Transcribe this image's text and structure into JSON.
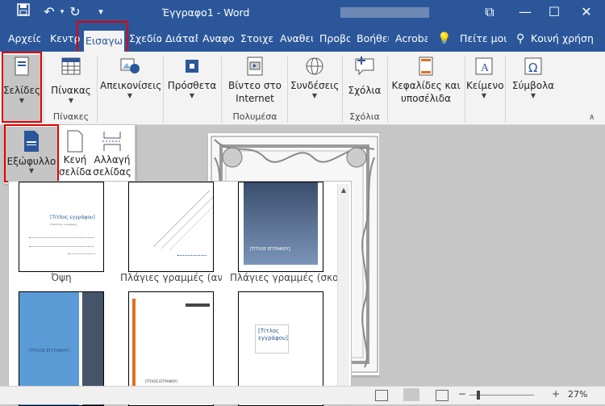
{
  "window": {
    "title": "Έγγραφο1 - Word",
    "controls": {
      "restore": "⧉",
      "minimize": "—",
      "maximize": "☐",
      "close": "✕"
    }
  },
  "quick_access": {
    "save": "save-icon",
    "undo": "undo-icon",
    "redo": "redo-icon",
    "customize": "▾"
  },
  "tabs": [
    {
      "label": "Αρχείο"
    },
    {
      "label": "Κεντρι"
    },
    {
      "label": "Εισαγω"
    },
    {
      "label": "Σχεδίασ"
    },
    {
      "label": "Διάταξ"
    },
    {
      "label": "Αναφοι"
    },
    {
      "label": "Στοιχεί"
    },
    {
      "label": "Αναθεύ"
    },
    {
      "label": "Προβο"
    },
    {
      "label": "Βοήθει"
    },
    {
      "label": "Acroba"
    }
  ],
  "tell_me": "Πείτε μοι",
  "share": "Κοινή χρήση",
  "ribbon": {
    "pages": "Σελίδες",
    "table": "Πίνακας",
    "illustrations": "Απεικονίσεις",
    "addins": "Πρόσθετα",
    "video_line1": "Βίντεο στο",
    "video_line2": "Internet",
    "links": "Συνδέσεις",
    "comment": "Σχόλια",
    "headers_line1": "Κεφαλίδες και",
    "headers_line2": "υποσέλιδα",
    "text": "Κείμενο",
    "symbols": "Σύμβολα",
    "group_tables": "Πίνακες",
    "group_media": "Πολυμέσα",
    "group_comments": "Σχόλια"
  },
  "pages_panel": {
    "cover": "Εξώφυλλο",
    "blank_line1": "Κενή",
    "blank_line2": "σελίδα",
    "break_line1": "Αλλαγή",
    "break_line2": "σελίδας"
  },
  "gallery": {
    "items": [
      {
        "label": "Όψη",
        "title": "[Τίτλος εγγράφου]",
        "subtitle": "[Υπότιτλος εγγράφου]"
      },
      {
        "label": "Πλάγιες γραμμές (ανο",
        "title": "",
        "subtitle": ""
      },
      {
        "label": "Πλάγιες γραμμές (σκο",
        "title": "[ΤΙΤΛΟΣ ΕΓΓΡΑΦΟΥ]",
        "subtitle": ""
      }
    ],
    "row2": [
      {
        "title": "[ΤΙΤΛΟΣ ΕΓΓΡΑΦΟΥ]"
      },
      {
        "title": "[ΤΙΤΛΟΣ ΕΓΓΡΑΦΟΥ]"
      },
      {
        "title": "[Τίτλος εγγράφου]"
      }
    ]
  },
  "status": {
    "zoom": "27%"
  },
  "colors": {
    "brand": "#2b579a",
    "highlight": "#e00000"
  }
}
